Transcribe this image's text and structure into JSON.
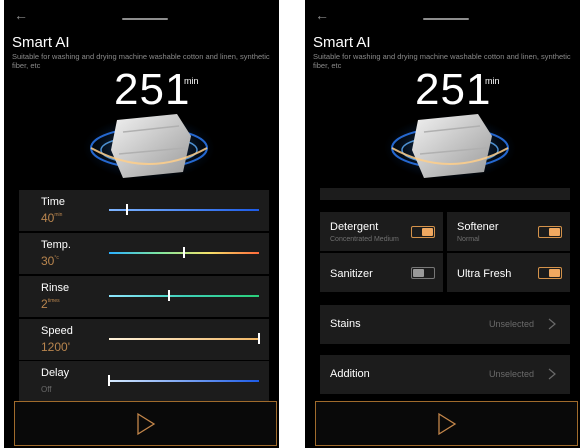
{
  "colors": {
    "accent": "#b8854e",
    "toggle_on": "#f0a860",
    "background": "#000000",
    "panel": "#1c1c1c"
  },
  "icons": {
    "back": "back-arrow-icon",
    "play": "play-icon",
    "chevron": "chevron-right-icon"
  },
  "common": {
    "back_glyph": "←",
    "title": "Smart AI",
    "description": "Suitable for washing and drying machine washable cotton and linen, synthetic fiber, etc",
    "remaining_time": "251",
    "remaining_unit": "min"
  },
  "settings": [
    {
      "label": "Time",
      "value": "40",
      "unit": "min",
      "level": 0.12
    },
    {
      "label": "Temp.",
      "value": "30",
      "unit": "°c",
      "level": 0.5
    },
    {
      "label": "Rinse",
      "value": "2",
      "unit": "times",
      "level": 0.4
    },
    {
      "label": "Speed",
      "value": "1200'",
      "unit": "",
      "level": 1.0
    },
    {
      "label": "Delay",
      "value": "Off",
      "unit": "",
      "level": 0.0
    }
  ],
  "options": {
    "detergent": {
      "label": "Detergent",
      "sub": "Concentrated Medium",
      "on": true
    },
    "softener": {
      "label": "Softener",
      "sub": "Normal",
      "on": true
    },
    "sanitizer": {
      "label": "Sanitizer",
      "on": false
    },
    "ultra_fresh": {
      "label": "Ultra Fresh",
      "on": true
    }
  },
  "stains": {
    "label": "Stains",
    "value": "Unselected"
  },
  "addition": {
    "label": "Addition",
    "value": "Unselected"
  }
}
